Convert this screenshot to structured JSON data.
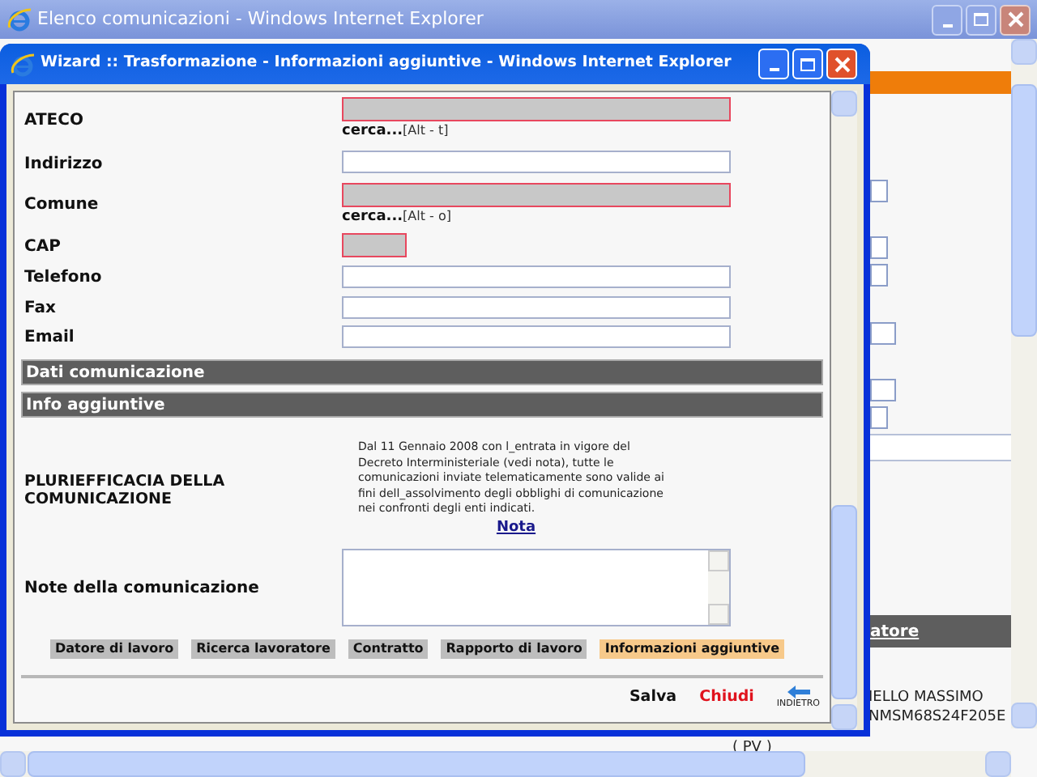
{
  "background_window": {
    "title": "Elenco comunicazioni - Windows Internet Explorer",
    "header_link": "atore",
    "cells": [
      "IELLO MASSIMO",
      "NMSM68S24F205E",
      "( PV )"
    ]
  },
  "wizard_window": {
    "title": "Wizard :: Trasformazione - Informazioni aggiuntive - Windows Internet Explorer",
    "fields": [
      {
        "label": "ATECO",
        "kind": "lookup",
        "required": true,
        "search": "cerca...",
        "shortcut": "[Alt - t]"
      },
      {
        "label": "Indirizzo",
        "kind": "text",
        "required": false
      },
      {
        "label": "Comune",
        "kind": "lookup",
        "required": true,
        "search": "cerca...",
        "shortcut": "[Alt - o]"
      },
      {
        "label": "CAP",
        "kind": "short",
        "required": true
      },
      {
        "label": "Telefono",
        "kind": "text",
        "required": false
      },
      {
        "label": "Fax",
        "kind": "text",
        "required": false
      },
      {
        "label": "Email",
        "kind": "text",
        "required": false
      }
    ],
    "sections": [
      "Dati comunicazione",
      "Info aggiuntive"
    ],
    "pluriefficacia": {
      "label": "PLURIEFFICACIA DELLA COMUNICAZIONE",
      "text": "Dal 11 Gennaio 2008 con l_entrata in vigore del Decreto Interministeriale (vedi nota), tutte le comunicazioni inviate telematicamente sono valide ai fini dell_assolvimento degli obblighi di comunicazione nei confronti degli enti indicati.",
      "link": "Nota"
    },
    "notes": {
      "label": "Note della comunicazione"
    },
    "steps": [
      {
        "label": "Datore di lavoro",
        "selected": false
      },
      {
        "label": "Ricerca lavoratore",
        "selected": false
      },
      {
        "label": "Contratto",
        "selected": false
      },
      {
        "label": "Rapporto di lavoro",
        "selected": false
      },
      {
        "label": "Informazioni aggiuntive",
        "selected": true
      }
    ],
    "actions": [
      {
        "label": "Salva",
        "kind": "save"
      },
      {
        "label": "Chiudi",
        "kind": "close"
      },
      {
        "label": "INDIETRO",
        "kind": "back"
      }
    ]
  }
}
